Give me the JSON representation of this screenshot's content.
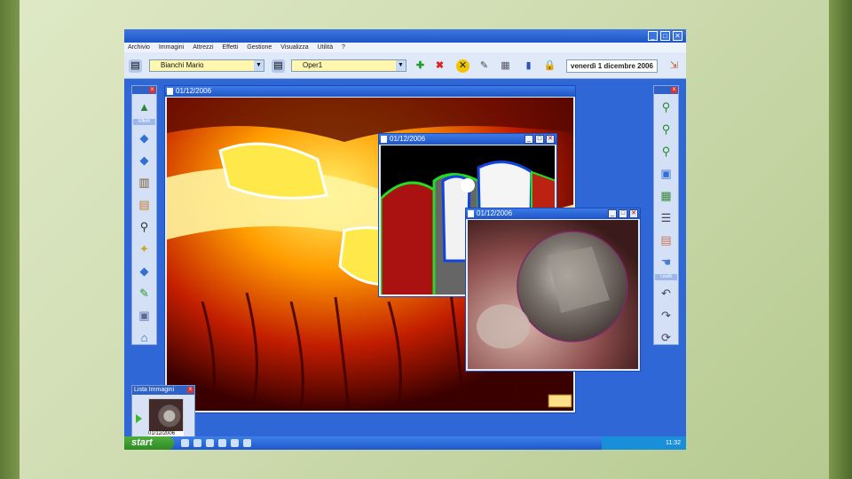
{
  "app": {
    "menu": [
      "Archivio",
      "Immagini",
      "Attrezzi",
      "Effetti",
      "Gestione",
      "Visualizza",
      "Utilità",
      "?"
    ],
    "patient": "Bianchi Mario",
    "operator": "Oper1",
    "date": "venerdì 1 dicembre 2006",
    "window_controls": [
      "_",
      "□",
      "✕"
    ]
  },
  "panels": {
    "left_section_label": "Effetti",
    "right_section_label": "Livelli"
  },
  "windows": {
    "main_title": "01/12/2006",
    "bitewing_title": "01/12/2006",
    "intraoral_title": "01/12/2006"
  },
  "image_list": {
    "title": "Lista Immagini",
    "thumb_date": "01/12/2006"
  },
  "taskbar": {
    "start_label": "start",
    "clock": "11:32"
  },
  "colors": {
    "desktop_bg": "#dfe9c6",
    "xp_blue": "#2f67d6",
    "start_green": "#3f9e32"
  }
}
